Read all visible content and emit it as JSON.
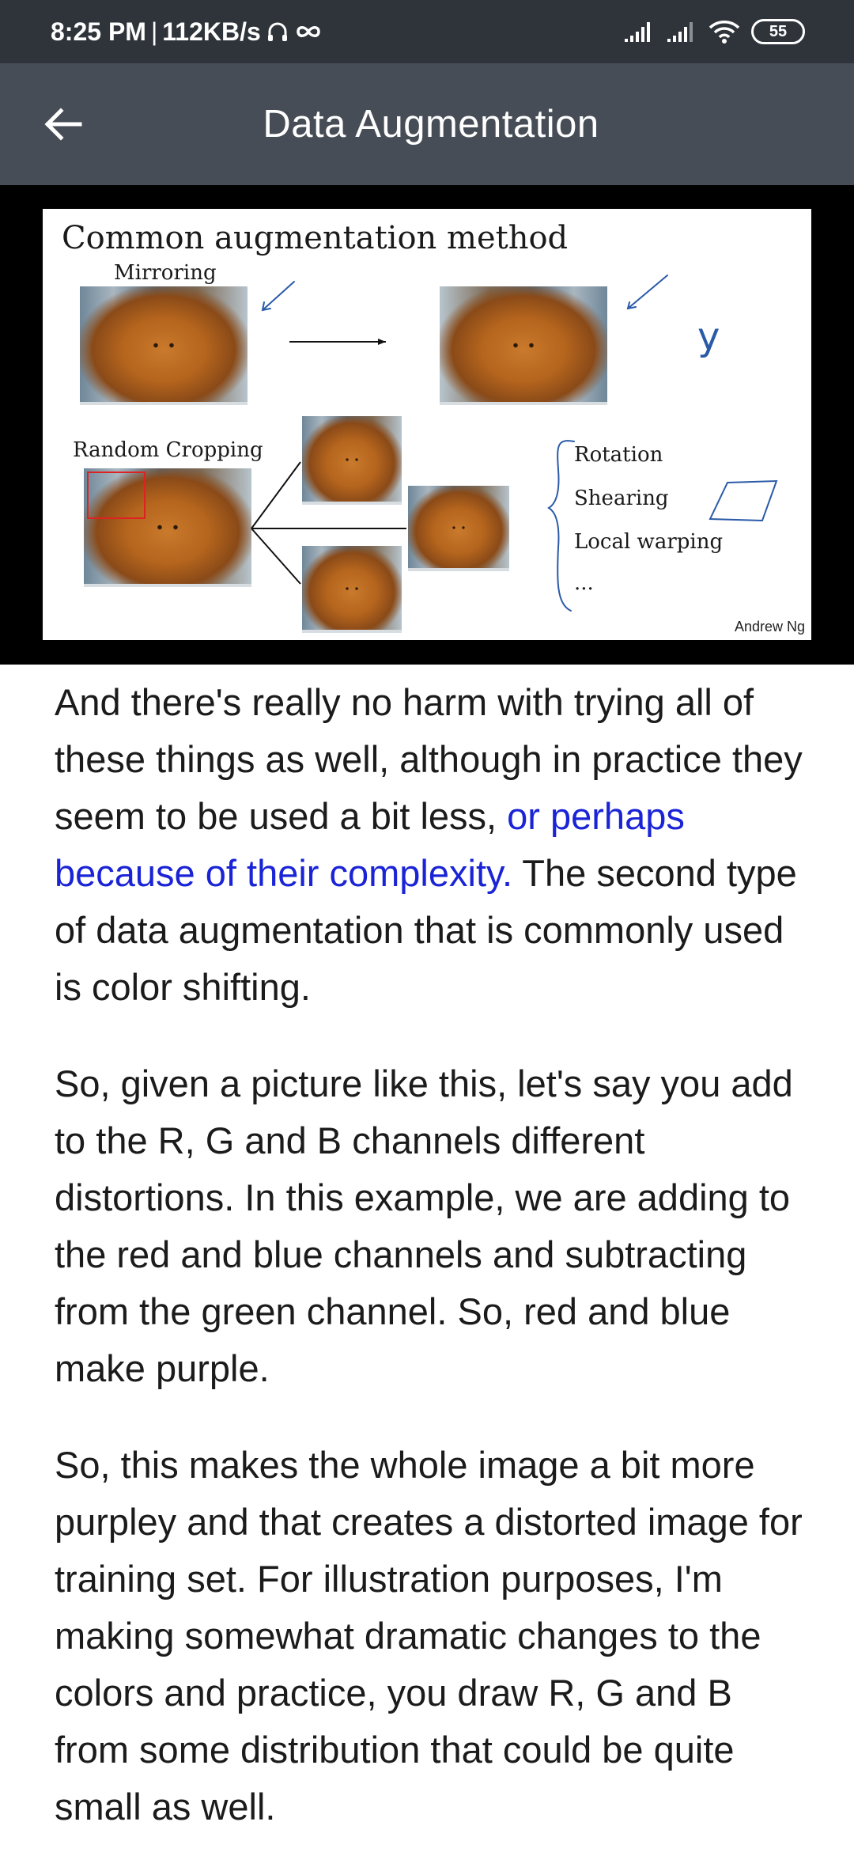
{
  "status_bar": {
    "time": "8:25 PM",
    "separator": "|",
    "network_speed": "112KB/s",
    "icons": [
      "headphones-icon",
      "infinity-icon",
      "signal-icon",
      "signal-icon",
      "wifi-icon"
    ],
    "battery": "55"
  },
  "app_bar": {
    "back_icon": "arrow-left-icon",
    "title": "Data Augmentation"
  },
  "slide": {
    "title": "Common augmentation method",
    "mirroring_label": "Mirroring",
    "cropping_label": "Random Cropping",
    "methods": [
      "Rotation",
      "Shearing",
      "Local warping",
      "..."
    ],
    "annotation_letter": "y",
    "credit": "Andrew Ng"
  },
  "article": {
    "p1_part1": "And there's really no harm with trying all of these things as well, although in practice they seem to be used a bit less, ",
    "p1_highlight": "or perhaps because of their complexity.",
    "p1_part2": " The second type of data augmentation that is commonly used is color shifting.",
    "p2": "So, given a picture like this, let's say you add to the R, G and B channels different distortions. In this example, we are adding to the red and blue channels and subtracting from the green channel. So, red and blue make purple.",
    "p3": "So, this makes the whole image a bit more purpley and that creates a distorted image for training set. For illustration purposes, I'm making somewhat dramatic changes to the colors and practice, you draw R, G and B from some distribution that could be quite small as well."
  },
  "colors": {
    "status_bar": "#2f343b",
    "app_bar": "#474d56",
    "highlight_text": "#1a24d6"
  }
}
